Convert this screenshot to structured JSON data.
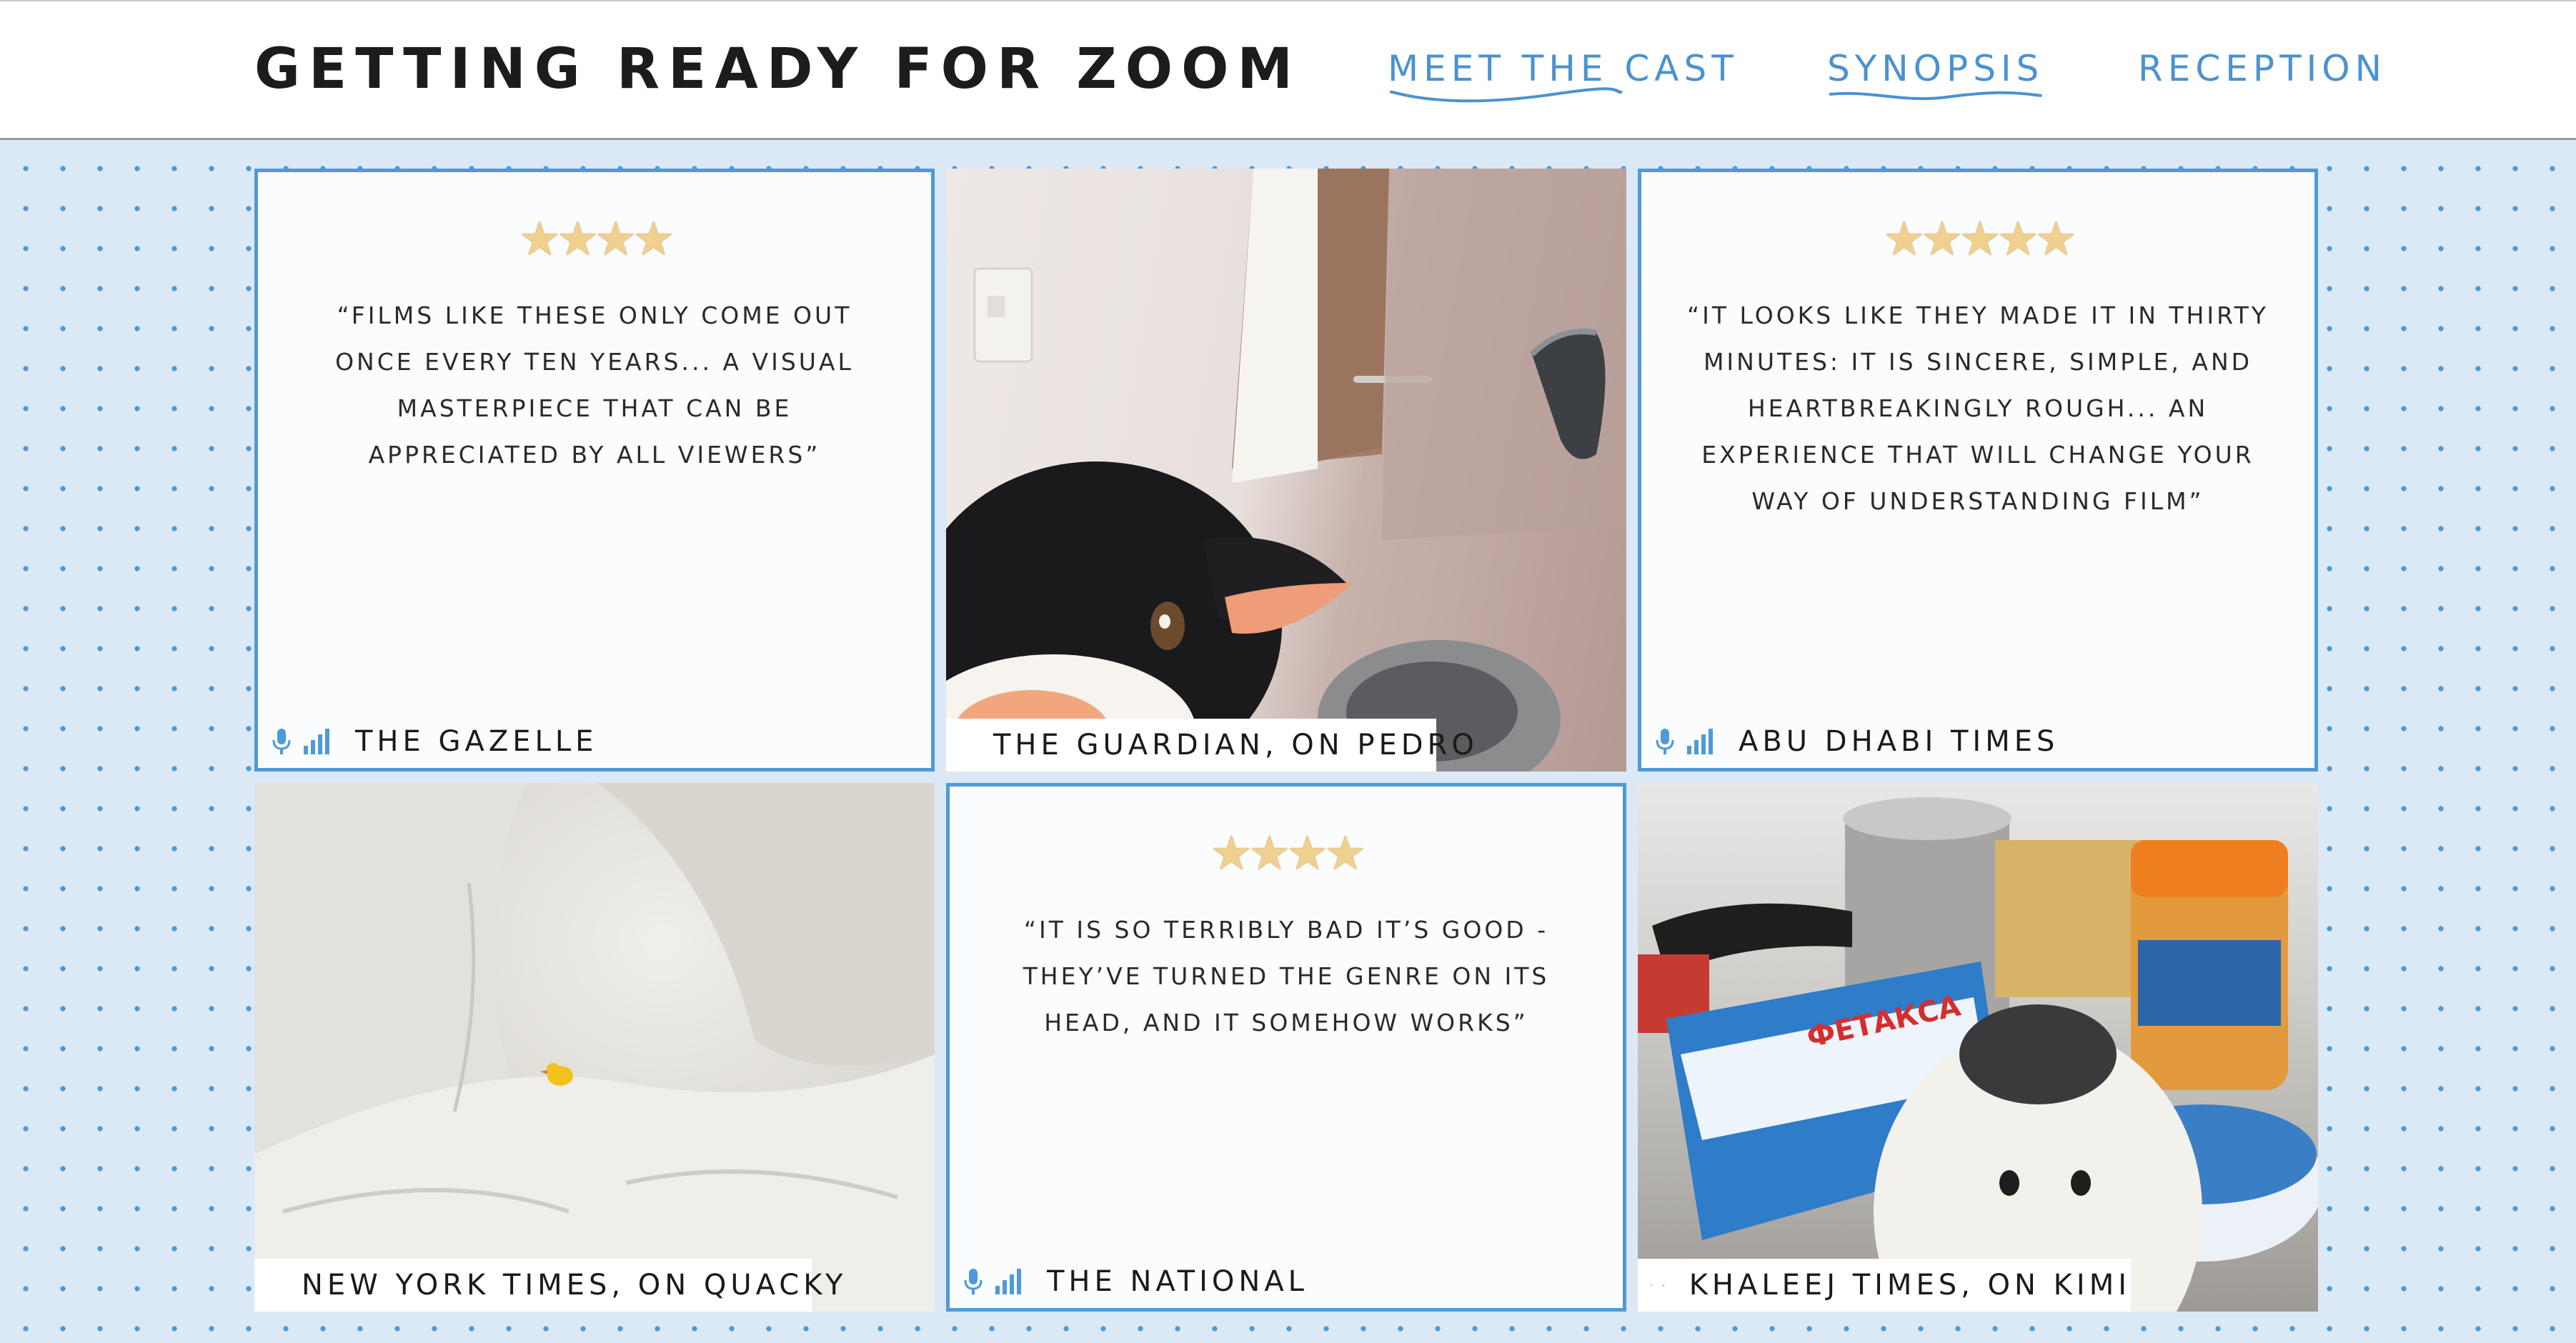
{
  "header": {
    "title": "GETTING READY FOR ZOOM",
    "nav": [
      "MEET THE CAST",
      "SYNOPSIS",
      "RECEPTION"
    ]
  },
  "colors": {
    "accent": "#4f9ad8",
    "background": "#dbe9f6",
    "star": "#f0d08e"
  },
  "reviews": [
    {
      "stars": "★★★★",
      "rating": 4,
      "quote": "“FILMS LIKE THESE ONLY COME OUT ONCE EVERY TEN YEARS... A VISUAL MASTERPIECE THAT CAN BE APPRECIATED BY ALL VIEWERS”",
      "source": "THE GAZELLE"
    },
    {
      "stars": "★★★★★",
      "rating": 5,
      "quote": "“IT LOOKS LIKE THEY MADE IT IN THIRTY MINUTES: IT IS SINCERE, SIMPLE, AND HEARTBREAKINGLY ROUGH... AN EXPERIENCE THAT WILL CHANGE YOUR WAY OF UNDERSTANDING FILM”",
      "source": "ABU DHABI TIMES"
    },
    {
      "stars": "★★★★",
      "rating": 4,
      "quote": "“IT IS SO TERRIBLY BAD IT’S GOOD - THEY’VE TURNED THE GENRE ON ITS HEAD, AND IT SOMEHOW WORKS”",
      "source": "THE NATIONAL"
    }
  ],
  "videos": [
    {
      "caption": "THE GUARDIAN, ON PEDRO"
    },
    {
      "caption": "NEW YORK TIMES, ON QUACKY"
    },
    {
      "caption": "KHALEEJ TIMES, ON KIMI"
    }
  ],
  "packaging": {
    "brand": "ФЕТАКСА"
  },
  "icons": {
    "mic": "microphone-icon",
    "signal": "signal-bars-icon"
  }
}
